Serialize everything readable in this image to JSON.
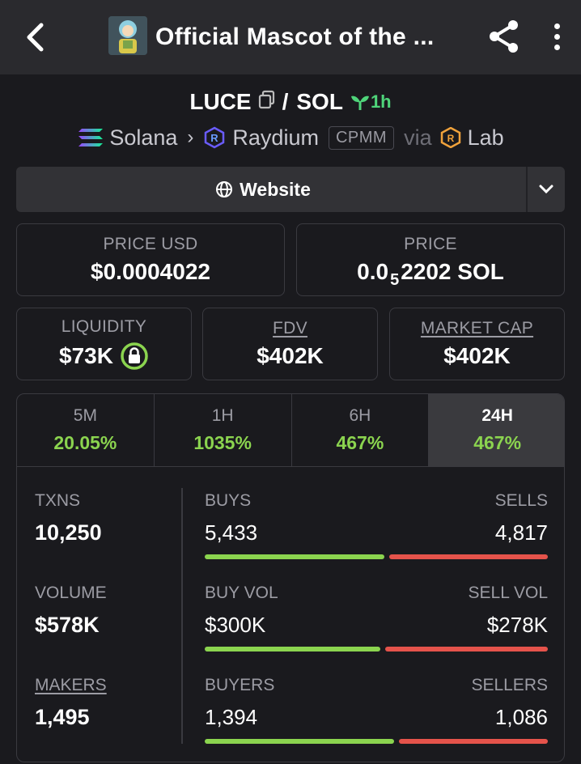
{
  "header": {
    "title": "Official Mascot of the ...",
    "icons": [
      "back-arrow-icon",
      "token-avatar",
      "share-icon",
      "more-vertical-icon"
    ]
  },
  "pair": {
    "base": "LUCE",
    "separator": "/",
    "quote": "SOL",
    "age": "1h",
    "chain": "Solana",
    "dex": "Raydium",
    "pool_type": "CPMM",
    "via_label": "via",
    "launchpad": "Lab"
  },
  "website_button": {
    "label": "Website"
  },
  "price_cards": {
    "usd_label": "PRICE USD",
    "usd_value": "$0.0004022",
    "native_label": "PRICE",
    "native_prefix": "0.0",
    "native_zeros": "5",
    "native_suffix": "2202 SOL"
  },
  "metrics_cards": {
    "liquidity_label": "LIQUIDITY",
    "liquidity_value": "$73K",
    "fdv_label": "FDV",
    "fdv_value": "$402K",
    "mcap_label": "MARKET CAP",
    "mcap_value": "$402K"
  },
  "timeframes": [
    {
      "label": "5M",
      "change": "20.05%"
    },
    {
      "label": "1H",
      "change": "1035%"
    },
    {
      "label": "6H",
      "change": "467%"
    },
    {
      "label": "24H",
      "change": "467%"
    }
  ],
  "active_timeframe": "24H",
  "stats": {
    "txns_label": "TXNS",
    "txns_value": "10,250",
    "volume_label": "VOLUME",
    "volume_value": "$578K",
    "makers_label": "MAKERS",
    "makers_value": "1,495",
    "buys_label": "BUYS",
    "buys_value": "5,433",
    "sells_label": "SELLS",
    "sells_value": "4,817",
    "buyvol_label": "BUY VOL",
    "buyvol_value": "$300K",
    "sellvol_label": "SELL VOL",
    "sellvol_value": "$278K",
    "buyers_label": "BUYERS",
    "buyers_value": "1,394",
    "sellers_label": "SELLERS",
    "sellers_value": "1,086",
    "buys_ratio": 0.53,
    "buyvol_ratio": 0.52,
    "buyers_ratio": 0.56
  },
  "colors": {
    "positive": "#8bd44f",
    "negative": "#e5534b",
    "age_green": "#4fd47a",
    "background": "#1a1a1e",
    "topbar": "#2a2a2e"
  }
}
